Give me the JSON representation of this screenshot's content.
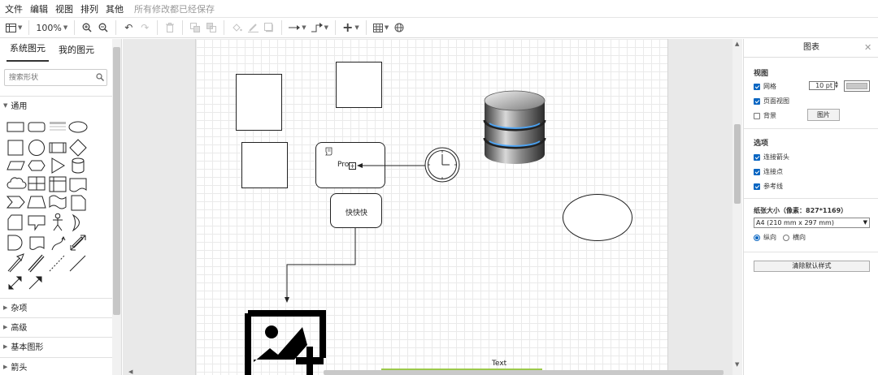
{
  "menu": {
    "items": [
      "文件",
      "编辑",
      "视图",
      "排列",
      "其他"
    ],
    "status": "所有修改都已经保存"
  },
  "toolbar": {
    "zoom": "100%"
  },
  "sidebar": {
    "tabs": [
      "系统图元",
      "我的图元"
    ],
    "search_placeholder": "搜索形状",
    "open_section": "通用",
    "sections": [
      "杂项",
      "高级",
      "基本图形",
      "箭头"
    ]
  },
  "canvas": {
    "process_label": "Pro",
    "rounded_label": "快快快",
    "text_label": "Text"
  },
  "panel": {
    "title": "图表",
    "view_heading": "视图",
    "grid_label": "网格",
    "grid_size": "10 pt",
    "page_view_label": "页面视图",
    "background_label": "背景",
    "image_button": "图片",
    "options_heading": "选项",
    "connection_arrows": "连接箭头",
    "connection_points": "连接点",
    "guides": "参考线",
    "paper_size_heading": "纸张大小（像素：827*1169）",
    "paper_size_value": "A4 (210 mm x 297 mm)",
    "portrait": "纵向",
    "landscape": "横向",
    "clear_style_button": "清除默认样式"
  },
  "colors": {
    "accent": "#0a66c2",
    "text_line": "#9cc94b"
  }
}
